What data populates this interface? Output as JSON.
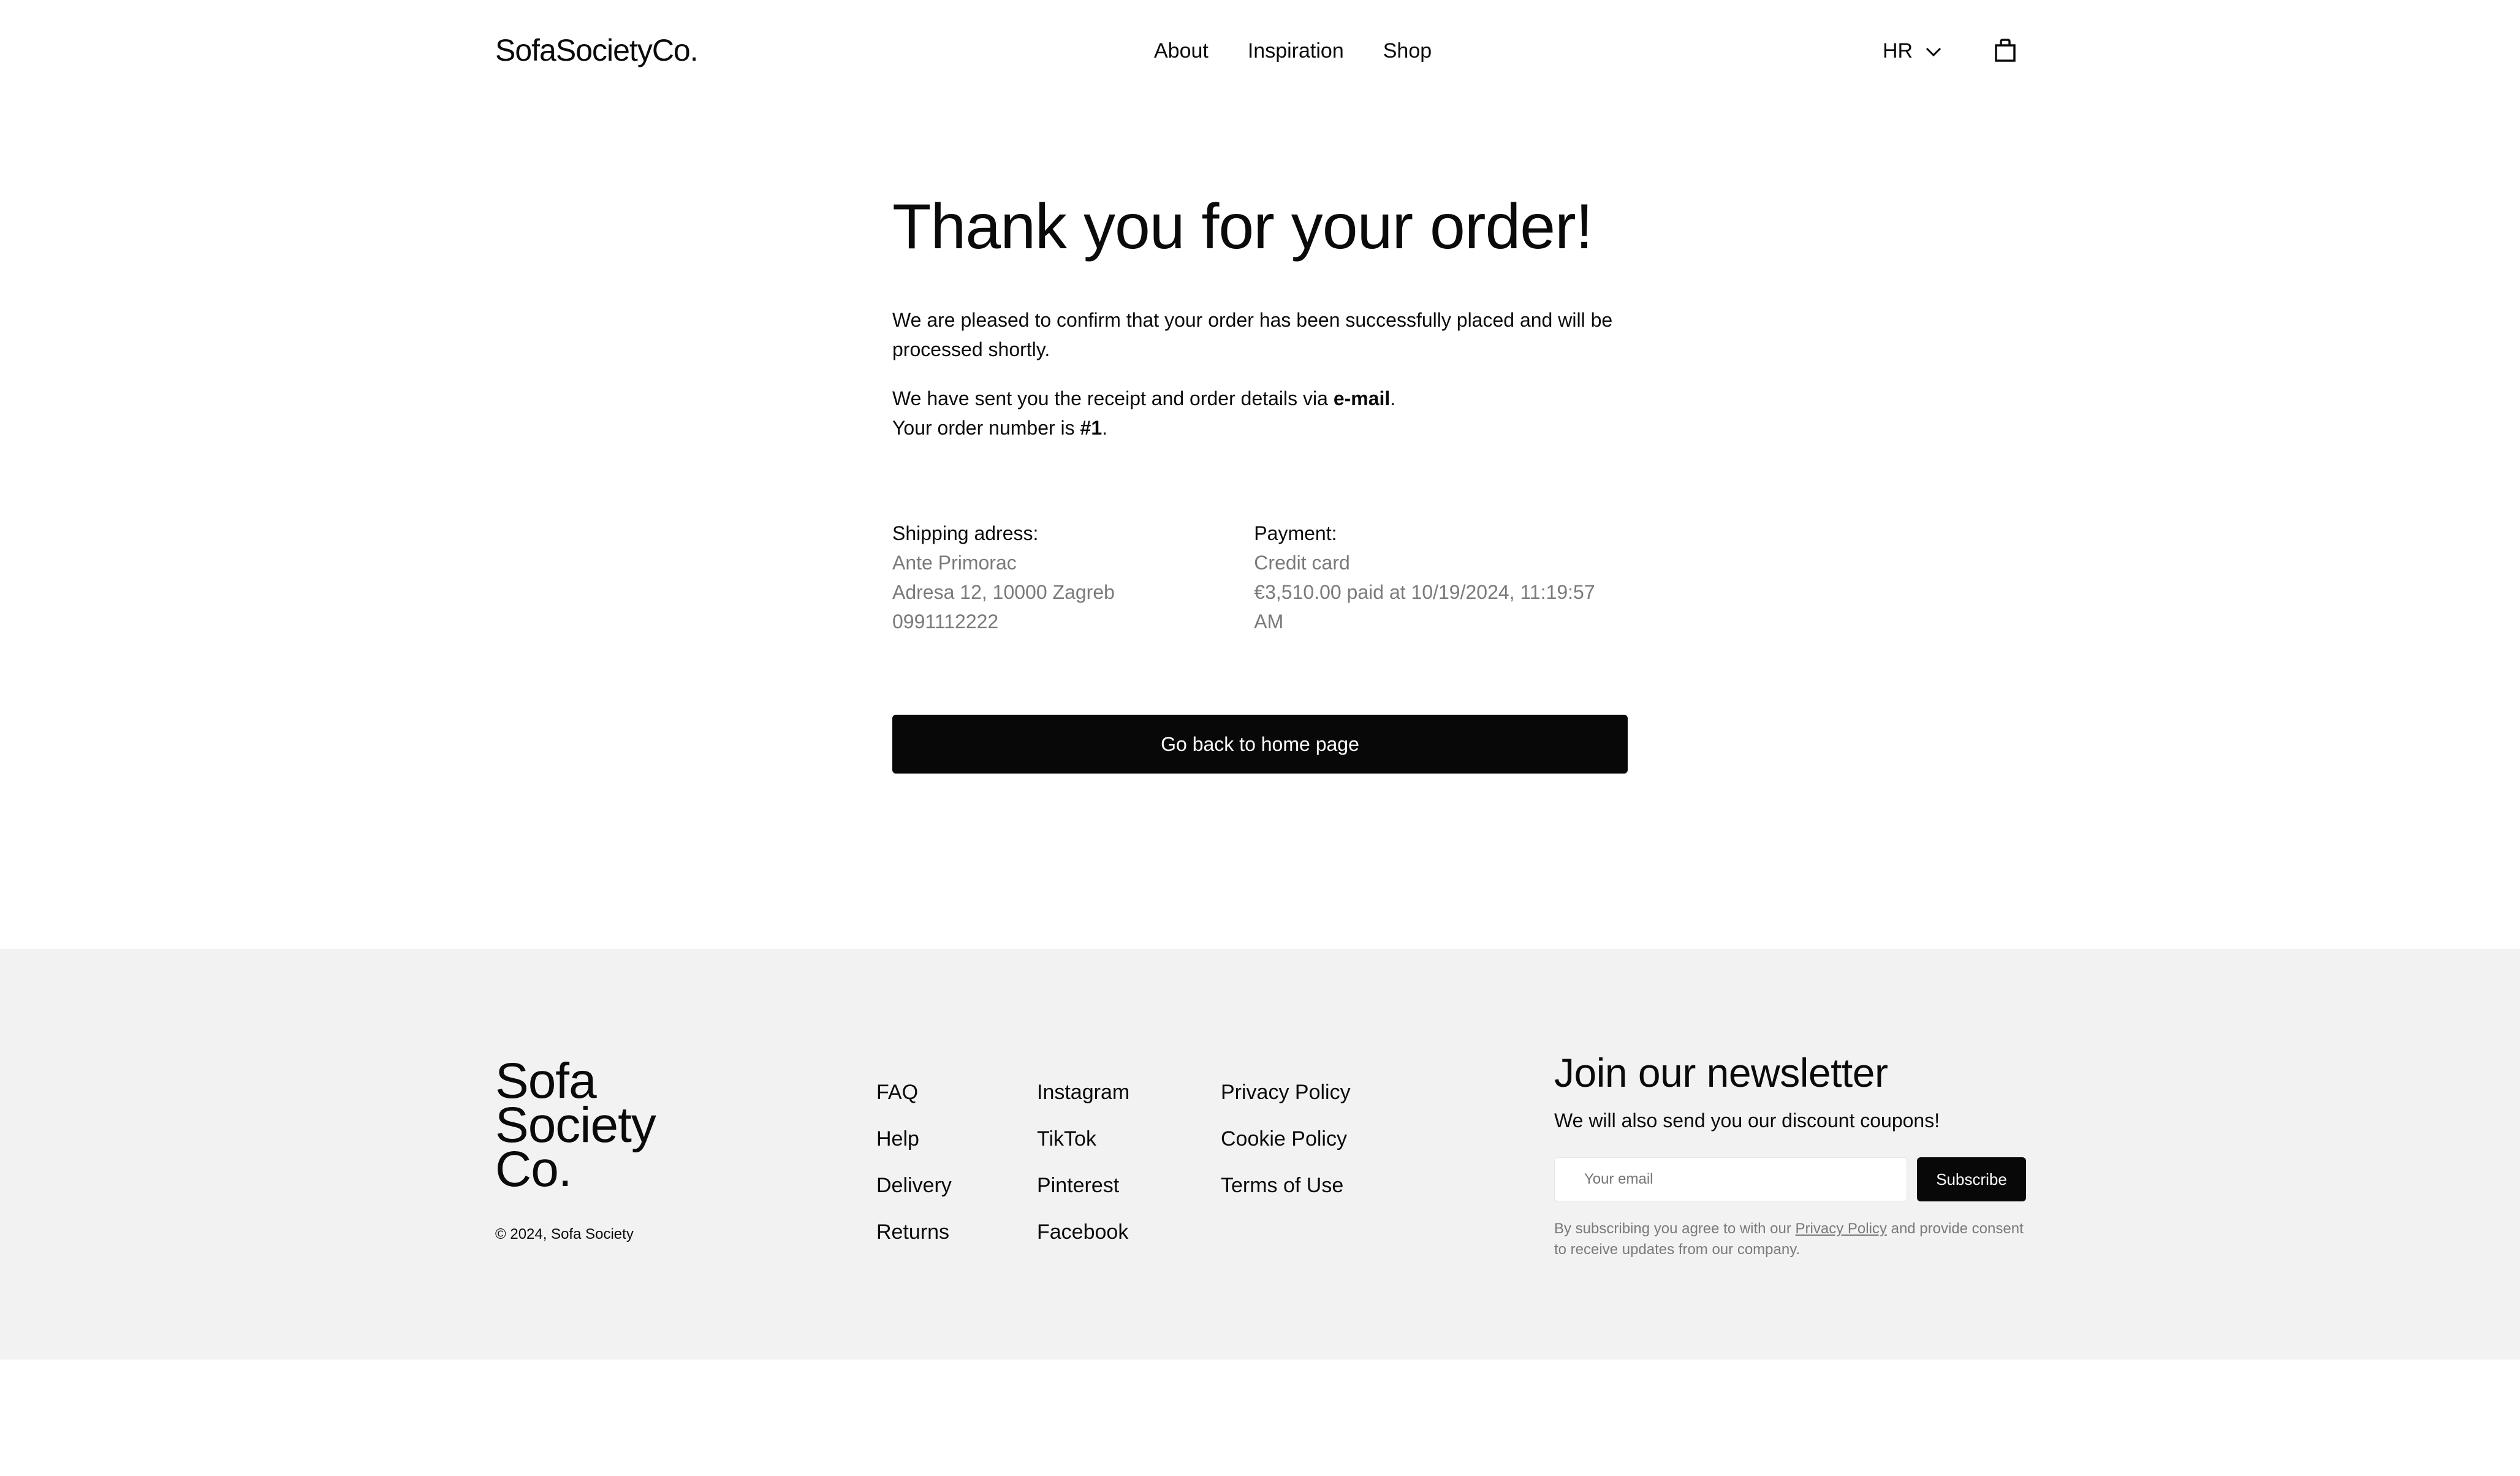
{
  "header": {
    "logo": "SofaSocietyCo.",
    "nav": [
      "About",
      "Inspiration",
      "Shop"
    ],
    "region": "HR",
    "icons": {
      "region_dropdown": "chevron-down-icon",
      "cart": "shopping-bag-icon"
    }
  },
  "main": {
    "title": "Thank you for your order!",
    "confirmation": "We are pleased to confirm that your order has been successfully placed and will be processed shortly.",
    "receipt_prefix": "We have sent you the receipt and order details via ",
    "receipt_method": "e-mail",
    "receipt_suffix": ".",
    "order_prefix": "Your order number is ",
    "order_number": "#1",
    "order_suffix": ".",
    "shipping": {
      "label": "Shipping adress:",
      "name": "Ante Primorac",
      "address": "Adresa 12, 10000 Zagreb",
      "phone": "0991112222"
    },
    "payment": {
      "label": "Payment:",
      "method": "Credit card",
      "summary": "€3,510.00 paid at 10/19/2024, 11:19:57 AM"
    },
    "button": "Go back to home page"
  },
  "footer": {
    "logo_lines": [
      "Sofa",
      "Society",
      "Co."
    ],
    "copyright": "© 2024, Sofa Society",
    "col1": [
      "FAQ",
      "Help",
      "Delivery",
      "Returns"
    ],
    "col2": [
      "Instagram",
      "TikTok",
      "Pinterest",
      "Facebook"
    ],
    "col3": [
      "Privacy Policy",
      "Cookie Policy",
      "Terms of Use"
    ],
    "newsletter": {
      "title": "Join our newsletter",
      "subtitle": "We will also send you our discount coupons!",
      "placeholder": "Your email",
      "button": "Subscribe",
      "note_prefix": "By subscribing you agree to with our ",
      "note_link": "Privacy Policy",
      "note_suffix": " and provide consent to receive updates from our company."
    }
  },
  "colors": {
    "primary": "#080808",
    "footer_bg": "#f2f2f2",
    "muted_text": "#7a7a7a"
  }
}
